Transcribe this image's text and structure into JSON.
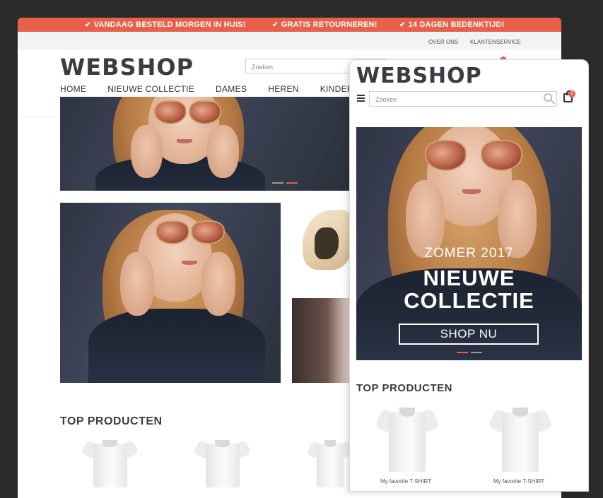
{
  "promo": [
    {
      "icon": "✔",
      "text": "VANDAAG BESTELD MORGEN IN HUIS!"
    },
    {
      "icon": "✔",
      "text": "GRATIS RETOURNEREN!"
    },
    {
      "icon": "✔",
      "text": "14 DAGEN BEDENKTIJD!"
    }
  ],
  "top_links": [
    "OVER ONS",
    "KLANTENSERVICE"
  ],
  "desktop": {
    "logo": "WEBSHOP",
    "search_placeholder": "Zoeken",
    "nav": [
      "HOME",
      "NIEUWE COLLECTIE",
      "DAMES",
      "HEREN",
      "KINDEREN"
    ],
    "top_products_title": "TOP PRODUCTEN"
  },
  "mobile": {
    "logo": "WEBSHOP",
    "search_placeholder": "Zoeken",
    "cart_count": "0",
    "hero_kicker": "ZOMER 2017",
    "hero_title_1": "NIEUWE",
    "hero_title_2": "COLLECTIE",
    "hero_button": "SHOP NU",
    "top_products_title": "TOP PRODUCTEN",
    "products": [
      {
        "name": "My favorite T-SHIRT"
      },
      {
        "name": "My favorite T-SHIRT"
      }
    ]
  },
  "colors": {
    "accent": "#e8604a",
    "dark": "#393d43",
    "background": "#2a2a2a"
  },
  "icons": [
    "check-icon",
    "search-icon",
    "hamburger-menu-icon",
    "shopping-bag-icon"
  ]
}
